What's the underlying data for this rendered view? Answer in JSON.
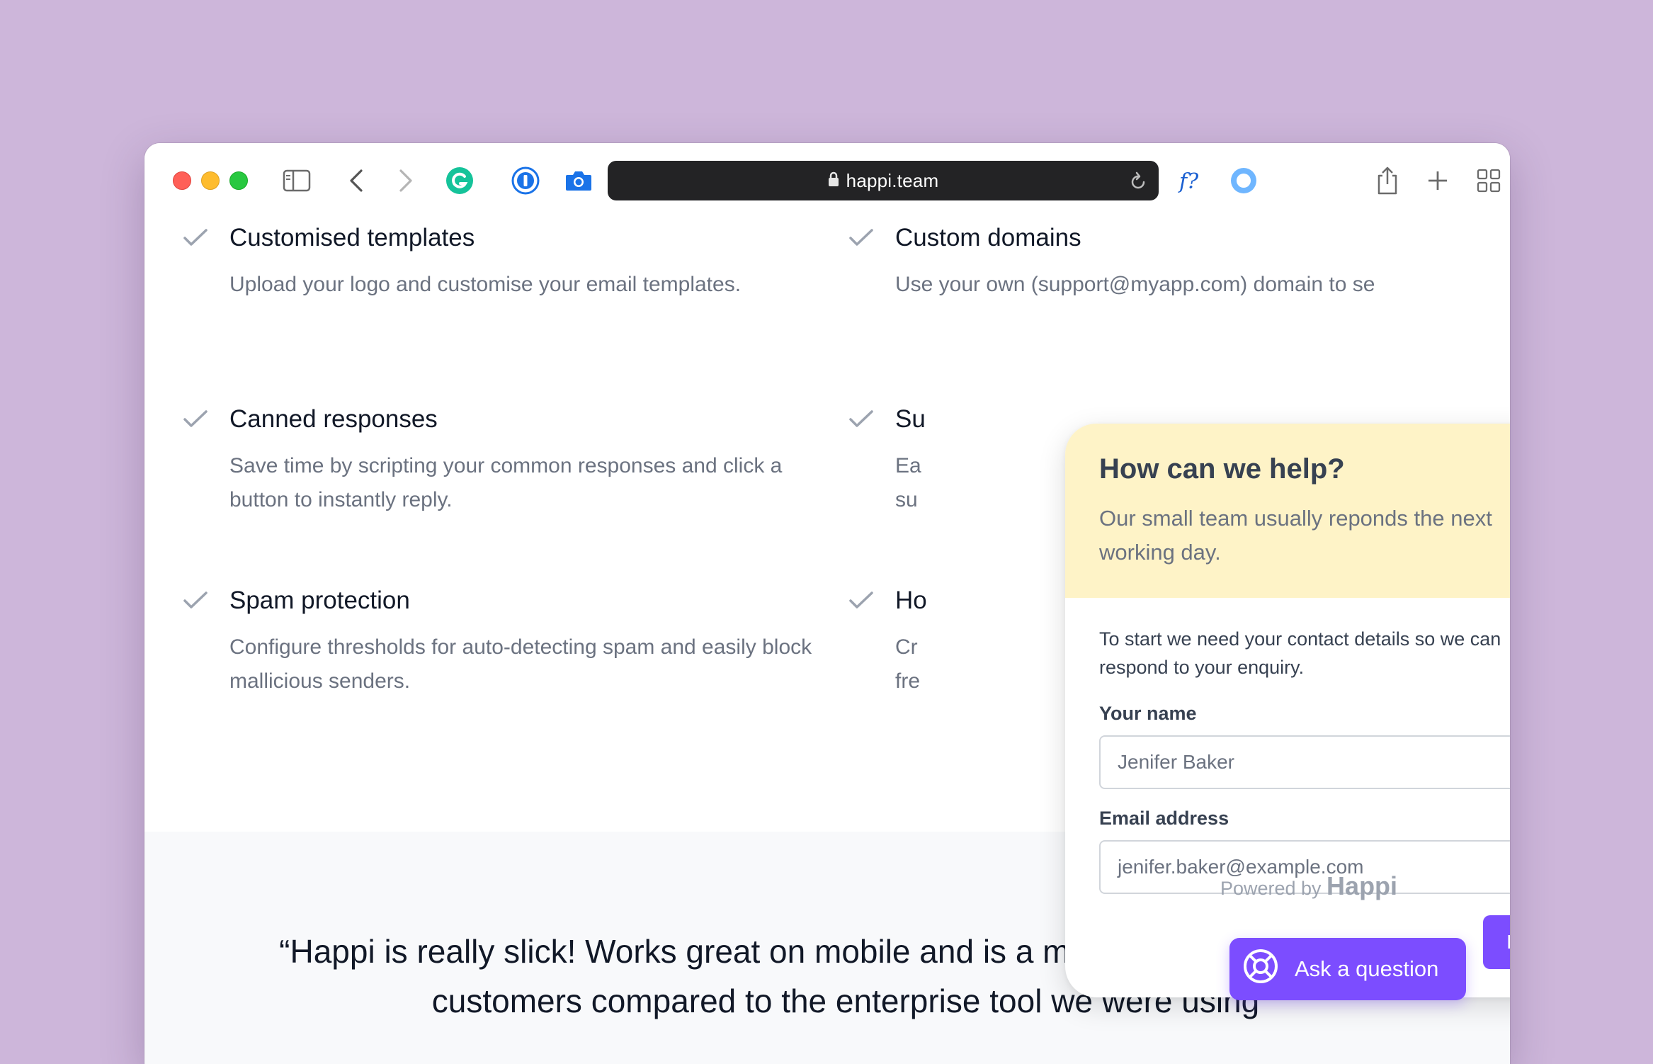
{
  "browser": {
    "url": "happi.team"
  },
  "features": [
    {
      "title": "Customised templates",
      "desc": "Upload your logo and customise your email templates."
    },
    {
      "title": "Custom domains",
      "desc": "Use your own (support@myapp.com) domain to se"
    },
    {
      "title": "Canned responses",
      "desc": "Save time by scripting your common responses and click a button to instantly reply."
    },
    {
      "title": "Su",
      "desc": "Ea su"
    },
    {
      "title": "Spam protection",
      "desc": "Configure thresholds for auto-detecting spam and easily block mallicious senders."
    },
    {
      "title": "Ho",
      "desc": "Cr fre"
    }
  ],
  "widget": {
    "title": "How can we help?",
    "subtitle": "Our small team usually reponds the next working day.",
    "intro": "To start we need your contact details so we can respond to your enquiry.",
    "name_label": "Your name",
    "name_value": "Jenifer Baker",
    "email_label": "Email address",
    "email_value": "jenifer.baker@example.com",
    "next_label": "Next"
  },
  "powered": {
    "prefix": "Powered by",
    "brand": "Happi"
  },
  "ask_button": {
    "label": "Ask a question"
  },
  "quote": {
    "text": "“Happi is really slick! Works great on mobile and is a much nicer engaging with customers compared to the enterprise tool we were using"
  },
  "colors": {
    "accent": "#7c4dff",
    "widget_header": "#fef3c7",
    "background": "#cdb6da"
  },
  "icons": [
    "sidebar-icon",
    "back-icon",
    "forward-icon",
    "grammarly-icon",
    "password-manager-icon",
    "camera-icon",
    "lock-icon",
    "reload-icon",
    "font-finder-icon",
    "circle-extension-icon",
    "share-icon",
    "new-tab-icon",
    "tab-overview-icon",
    "checkmark-icon",
    "close-icon",
    "lifebuoy-icon"
  ]
}
